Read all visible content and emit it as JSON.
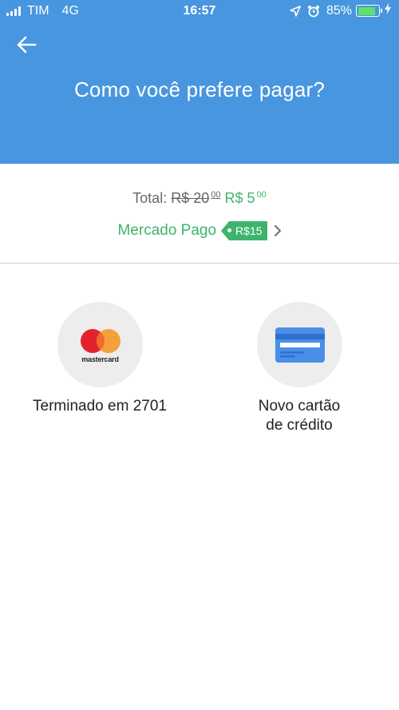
{
  "status_bar": {
    "carrier": "TIM",
    "network": "4G",
    "time": "16:57",
    "battery_percent": "85%",
    "battery_level": 0.85
  },
  "header": {
    "title": "Como você prefere pagar?",
    "background_color": "#4796df"
  },
  "summary": {
    "total_label": "Total:",
    "old_price_main": "R$ 20",
    "old_price_cents": "00",
    "new_price_main": "R$ 5",
    "new_price_cents": "00",
    "discount_provider": "Mercado Pago",
    "discount_tag": "R$15",
    "accent_color": "#3db46d"
  },
  "options": [
    {
      "label": "Terminado em 2701",
      "brand": "mastercard",
      "icon": "mastercard-logo"
    },
    {
      "label_line1": "Novo cartão",
      "label_line2": "de crédito",
      "icon": "credit-card-icon"
    }
  ]
}
